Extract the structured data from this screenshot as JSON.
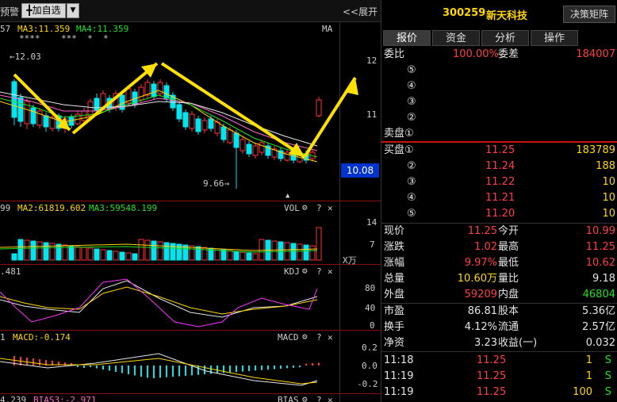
{
  "toolbar": {
    "left_label": "预警",
    "add_button": "╋加自选",
    "dropdown_glyph": "▼",
    "expand_label": "<<展开"
  },
  "main_chart": {
    "ma_label_left": "57",
    "ma3_label": "MA3:11.359",
    "ma4_label": "MA4:11.359",
    "ma_tag": "MA",
    "stars": "****    ***  *  *",
    "high_annot": "←12.03",
    "low_annot": "9.66→",
    "axis_ticks": [
      "12",
      "11"
    ],
    "price_box": "10.08",
    "triangle": "▲"
  },
  "vol_panel": {
    "label_left": "99",
    "ma2": "MA2:61819.602",
    "ma3": "MA3:59548.199",
    "name": "VOL",
    "axis_ticks": [
      "14",
      "7"
    ],
    "unit": "X万"
  },
  "kdj_panel": {
    "label_left": ".481",
    "name": "KDJ",
    "axis_ticks": [
      "80",
      "40",
      "0"
    ]
  },
  "macd_panel": {
    "label_left": "1",
    "macd": "MACD:-0.174",
    "name": "MACD",
    "axis_ticks": [
      "0.2",
      "0.0",
      "-0.2"
    ]
  },
  "bias_panel": {
    "label_left": "4.239",
    "bias3": "BIAS3:-2.971",
    "name": "BIAS"
  },
  "panel_icons": {
    "gear": "⚙",
    "help": "?",
    "close": "✕"
  },
  "quote": {
    "code": "300259",
    "name": "新天科技",
    "decision_button": "决策矩阵",
    "tabs": [
      "报价",
      "资金",
      "分析",
      "操作"
    ],
    "weibi_label": "委比",
    "weibi_value": "100.00%",
    "weicha_label": "委差",
    "weicha_value": "184007",
    "sell_levels": [
      "⑤",
      "④",
      "③",
      "②"
    ],
    "sell_label": "卖盘①",
    "buy_rows": [
      {
        "label": "买盘①",
        "price": "11.25",
        "vol": "183789"
      },
      {
        "label": "②",
        "price": "11.24",
        "vol": "188"
      },
      {
        "label": "③",
        "price": "11.22",
        "vol": "10"
      },
      {
        "label": "④",
        "price": "11.21",
        "vol": "10"
      },
      {
        "label": "⑤",
        "price": "11.20",
        "vol": "10"
      }
    ],
    "stats": [
      {
        "l1": "现价",
        "v1": "11.25",
        "c1": "red",
        "l2": "今开",
        "v2": "10.99",
        "c2": "red"
      },
      {
        "l1": "涨跌",
        "v1": "1.02",
        "c1": "red",
        "l2": "最高",
        "v2": "11.25",
        "c2": "red"
      },
      {
        "l1": "涨幅",
        "v1": "9.97%",
        "c1": "red",
        "l2": "最低",
        "v2": "10.62",
        "c2": "red"
      },
      {
        "l1": "总量",
        "v1": "10.60万",
        "c1": "yellow",
        "l2": "量比",
        "v2": "9.18",
        "c2": "white"
      },
      {
        "l1": "外盘",
        "v1": "59209",
        "c1": "red",
        "l2": "内盘",
        "v2": "46804",
        "c2": "green"
      }
    ],
    "fund": [
      {
        "l1": "市盈",
        "v1": "86.81",
        "l2": "股本",
        "v2": "5.36亿"
      },
      {
        "l1": "换手",
        "v1": "4.12%",
        "l2": "流通",
        "v2": "2.57亿"
      },
      {
        "l1": "净资",
        "v1": "3.23",
        "l2": "收益(一)",
        "v2": "0.032"
      }
    ],
    "ticks": [
      {
        "time": "11:18",
        "price": "11.25",
        "vol": "1",
        "side": "S"
      },
      {
        "time": "11:19",
        "price": "11.25",
        "vol": "1",
        "side": "S"
      },
      {
        "time": "11:19",
        "price": "11.25",
        "vol": "100",
        "side": "S"
      }
    ]
  }
}
